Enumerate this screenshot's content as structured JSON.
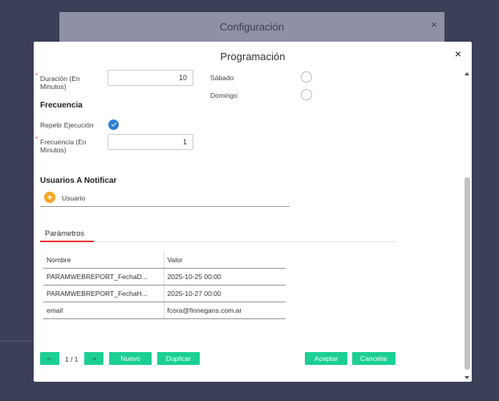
{
  "background_dialog": {
    "title": "Configuración",
    "close_label": "×"
  },
  "modal": {
    "title": "Programación",
    "close_label": "×"
  },
  "form": {
    "duracion": {
      "required_mark": "*",
      "label": "Duración (En Minutos)",
      "value": "10"
    },
    "frecuencia_section": "Frecuencia",
    "repetir": {
      "label": "Repetir Ejecución",
      "checked": true
    },
    "frecuencia": {
      "required_mark": "*",
      "label": "Frecuencia (En Minutos)",
      "value": "1"
    },
    "days": [
      {
        "label": "Sábado",
        "selected": false
      },
      {
        "label": "Domingo",
        "selected": false
      }
    ]
  },
  "notify": {
    "section_title": "Usuarios A Notificar",
    "add_icon": "+",
    "column_label": "Usuario"
  },
  "tabs": [
    {
      "label": "Parámetros",
      "active": true
    }
  ],
  "params_table": {
    "headers": [
      "Nombre",
      "Valor"
    ],
    "rows": [
      [
        "PARAMWEBREPORT_FechaD...",
        "2025-10-25 00:00"
      ],
      [
        "PARAMWEBREPORT_FechaH...",
        "2025-10-27 00:00"
      ],
      [
        "email",
        "fcora@finnegans.com.ar"
      ]
    ]
  },
  "footer": {
    "prev_icon": "←",
    "next_icon": "→",
    "pager": "1 / 1",
    "new_label": "Nuevo",
    "duplicate_label": "Duplicar",
    "accept_label": "Aceptar",
    "cancel_label": "Cancelar"
  },
  "colors": {
    "accent": "#1ccf95",
    "check": "#2f80d3",
    "tab_underline": "#e53935",
    "add_icon": "#f5a623"
  }
}
